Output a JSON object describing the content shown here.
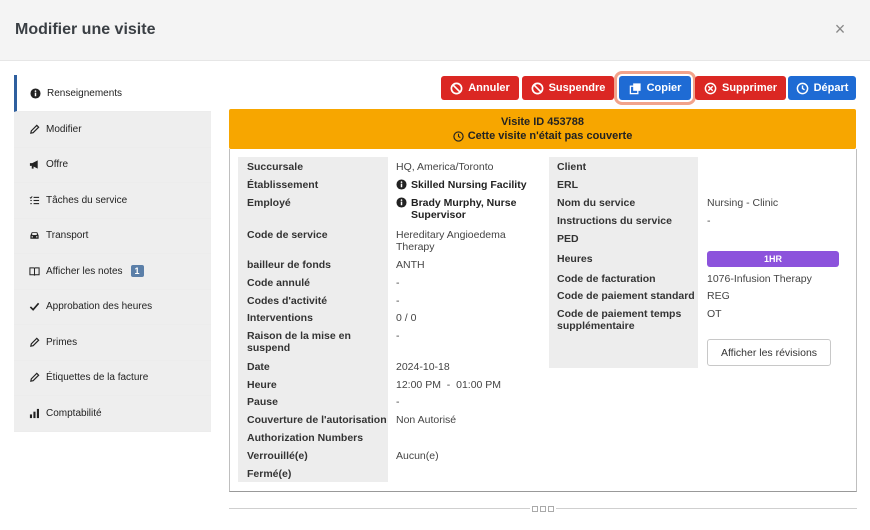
{
  "header": {
    "title": "Modifier une visite",
    "close": "×"
  },
  "sidebar": {
    "items": [
      {
        "label": "Renseignements",
        "icon": "info-icon"
      },
      {
        "label": "Modifier",
        "icon": "pencil-icon"
      },
      {
        "label": "Offre",
        "icon": "megaphone-icon"
      },
      {
        "label": "Tâches du service",
        "icon": "list-icon"
      },
      {
        "label": "Transport",
        "icon": "car-icon"
      },
      {
        "label": "Afficher les notes",
        "icon": "book-icon",
        "badge": "1"
      },
      {
        "label": "Approbation des heures",
        "icon": "check-icon"
      },
      {
        "label": "Primes",
        "icon": "pencil-icon"
      },
      {
        "label": "Étiquettes de la facture",
        "icon": "pencil-icon"
      },
      {
        "label": "Comptabilité",
        "icon": "bar-chart-icon"
      }
    ]
  },
  "toolbar": {
    "annuler": "Annuler",
    "suspendre": "Suspendre",
    "copier": "Copier",
    "supprimer": "Supprimer",
    "depart": "Départ"
  },
  "banner": {
    "line1": "Visite ID 453788",
    "line2": "Cette visite n'était pas couverte"
  },
  "left": [
    {
      "label": "Succursale",
      "value": "HQ, America/Toronto"
    },
    {
      "label": "Établissement",
      "value": "Skilled Nursing Facility"
    },
    {
      "label": "Employé",
      "value": "Brady Murphy, Nurse Supervisor"
    },
    {
      "label": "Code de service",
      "value": "Hereditary Angioedema Therapy"
    },
    {
      "label": "bailleur de fonds",
      "value": "ANTH"
    },
    {
      "label": "Code annulé",
      "value": "-"
    },
    {
      "label": "Codes d'activité",
      "value": "-"
    },
    {
      "label": "Interventions",
      "value": "0 / 0"
    },
    {
      "label": "Raison de la mise en suspend",
      "value": "-"
    },
    {
      "label": "Date",
      "value": "2024-10-18"
    },
    {
      "label": "Heure",
      "value": "12:00 PM  -  01:00 PM"
    },
    {
      "label": "Pause",
      "value": "-"
    },
    {
      "label": "Couverture de l'autorisation",
      "value": "Non Autorisé"
    },
    {
      "label": "Authorization Numbers",
      "value": ""
    },
    {
      "label": "Verrouillé(e)",
      "value": "Aucun(e)"
    },
    {
      "label": "Fermé(e)",
      "value": ""
    }
  ],
  "right": [
    {
      "label": "Client",
      "value": ""
    },
    {
      "label": "ERL",
      "value": ""
    },
    {
      "label": "Nom du service",
      "value": "Nursing - Clinic"
    },
    {
      "label": "Instructions du service",
      "value": "-"
    },
    {
      "label": "PED",
      "value": ""
    },
    {
      "label": "Heures",
      "value": "1HR"
    },
    {
      "label": "Code de facturation",
      "value": "1076-Infusion Therapy"
    },
    {
      "label": "Code de paiement standard",
      "value": "REG"
    },
    {
      "label": "Code de paiement temps supplémentaire",
      "value": "OT"
    }
  ],
  "revisions_button": "Afficher les révisions",
  "colors": {
    "red": "#db2723",
    "blue": "#1e6bd4",
    "banner": "#f7a600",
    "pill": "#8c53dc"
  }
}
